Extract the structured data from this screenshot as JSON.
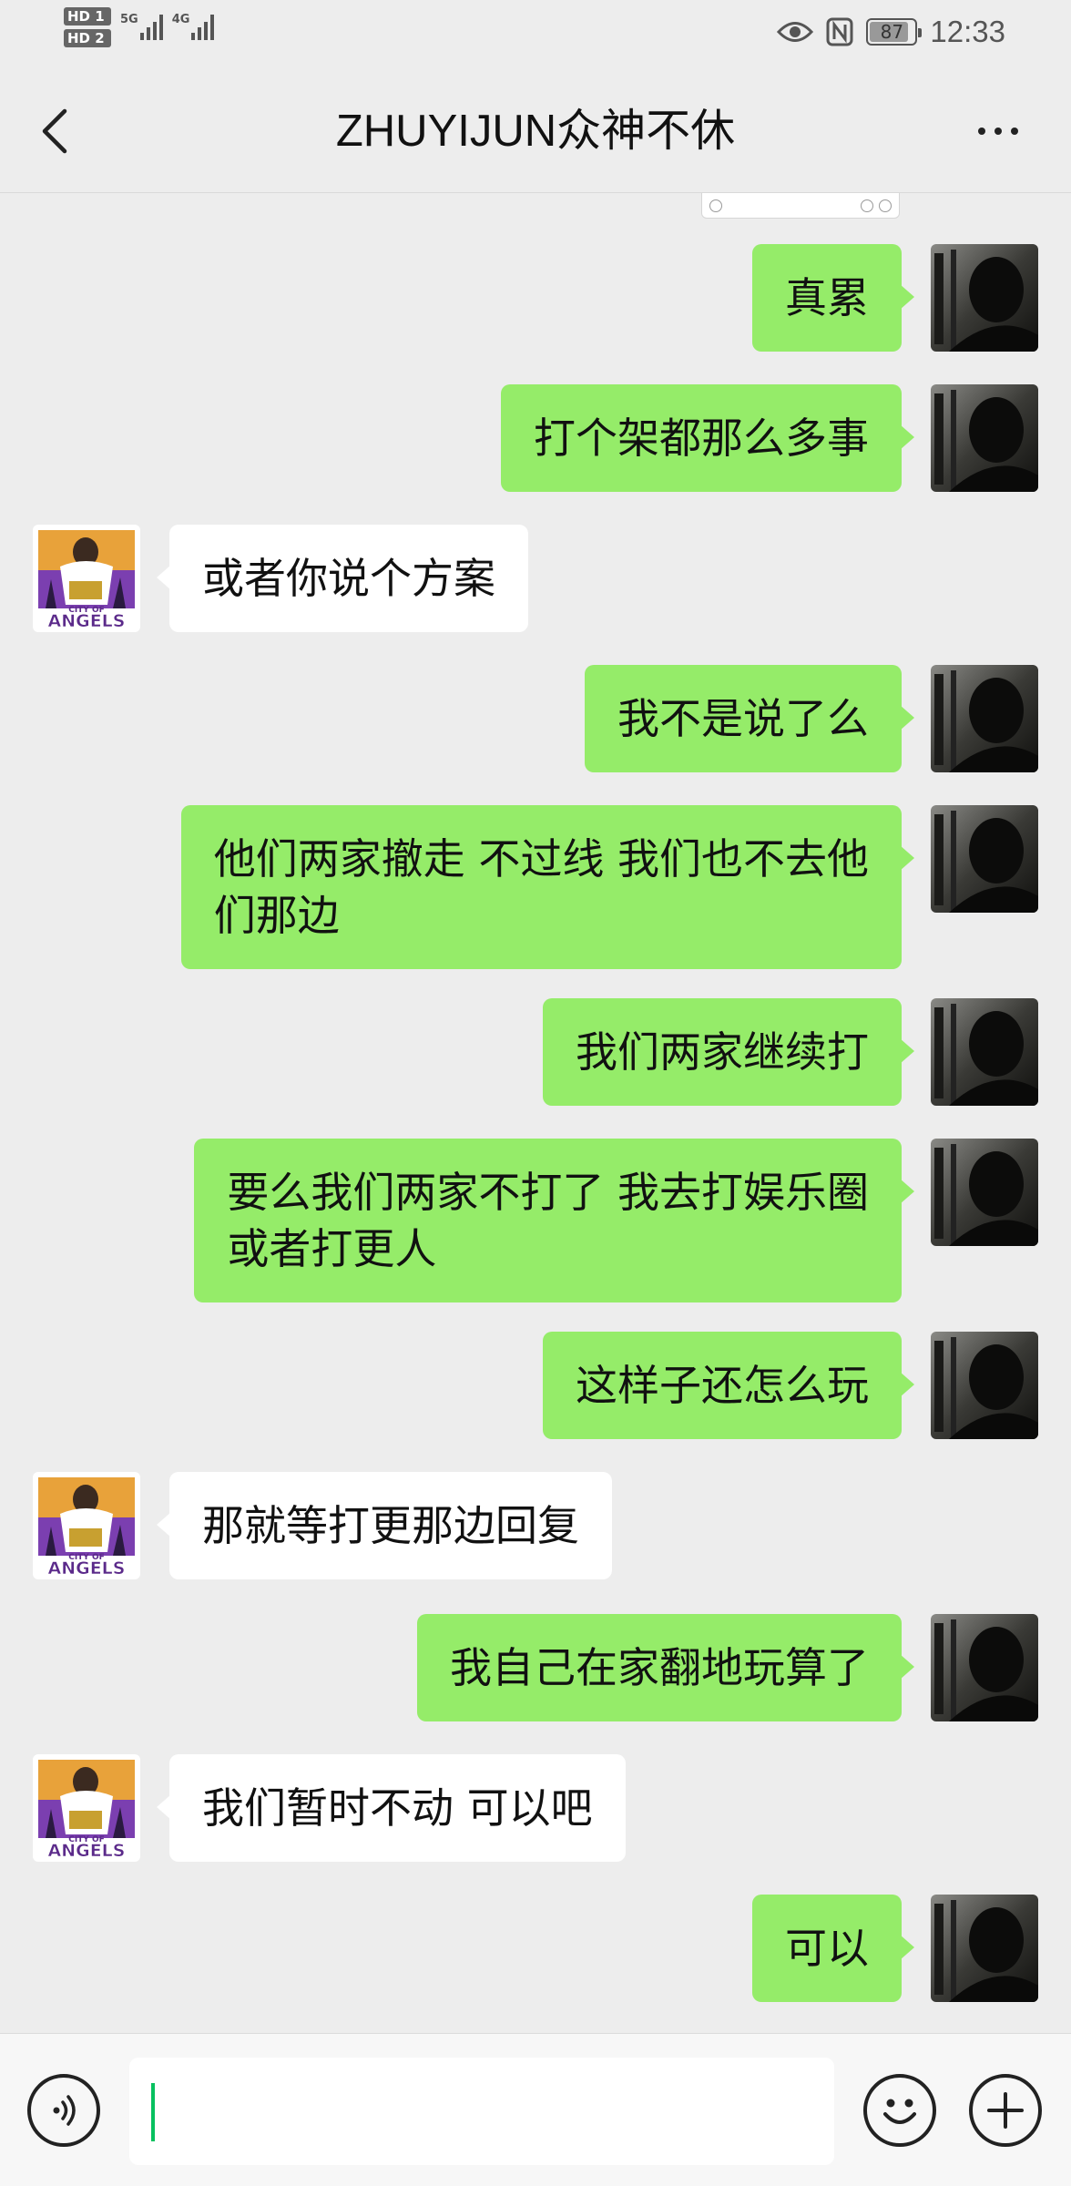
{
  "status_bar": {
    "sim1": "HD 1",
    "sim2": "HD 2",
    "network1": "5G",
    "network2": "4G",
    "battery": "87",
    "battery_level": 0.87,
    "time": "12:33"
  },
  "header": {
    "title": "ZHUYIJUN众神不休",
    "back_icon": "chevron-left-icon",
    "more_icon": "more-dots-icon"
  },
  "messages": [
    {
      "sender": "self",
      "text": "真累"
    },
    {
      "sender": "self",
      "text": "打个架都那么多事"
    },
    {
      "sender": "other",
      "text": "或者你说个方案"
    },
    {
      "sender": "self",
      "text": "我不是说了么"
    },
    {
      "sender": "self",
      "text": "他们两家撤走 不过线 我们也不去他\n们那边"
    },
    {
      "sender": "self",
      "text": "我们两家继续打"
    },
    {
      "sender": "self",
      "text": "要么我们两家不打了 我去打娱乐圈\n或者打更人"
    },
    {
      "sender": "self",
      "text": "这样子还怎么玩"
    },
    {
      "sender": "other",
      "text": "那就等打更那边回复"
    },
    {
      "sender": "self",
      "text": "我自己在家翻地玩算了"
    },
    {
      "sender": "other",
      "text": "我们暂时不动 可以吧"
    },
    {
      "sender": "self",
      "text": "可以"
    }
  ],
  "other_avatar": {
    "logo_text": "ANGELS",
    "logo_subtext": "CITY OF"
  },
  "input_bar": {
    "value": "",
    "voice_icon": "voice-icon",
    "emoji_icon": "emoji-icon",
    "plus_icon": "plus-icon"
  },
  "colors": {
    "self_bubble": "#95ec69",
    "other_bubble": "#ffffff",
    "background": "#ededed",
    "caret": "#07c160"
  }
}
